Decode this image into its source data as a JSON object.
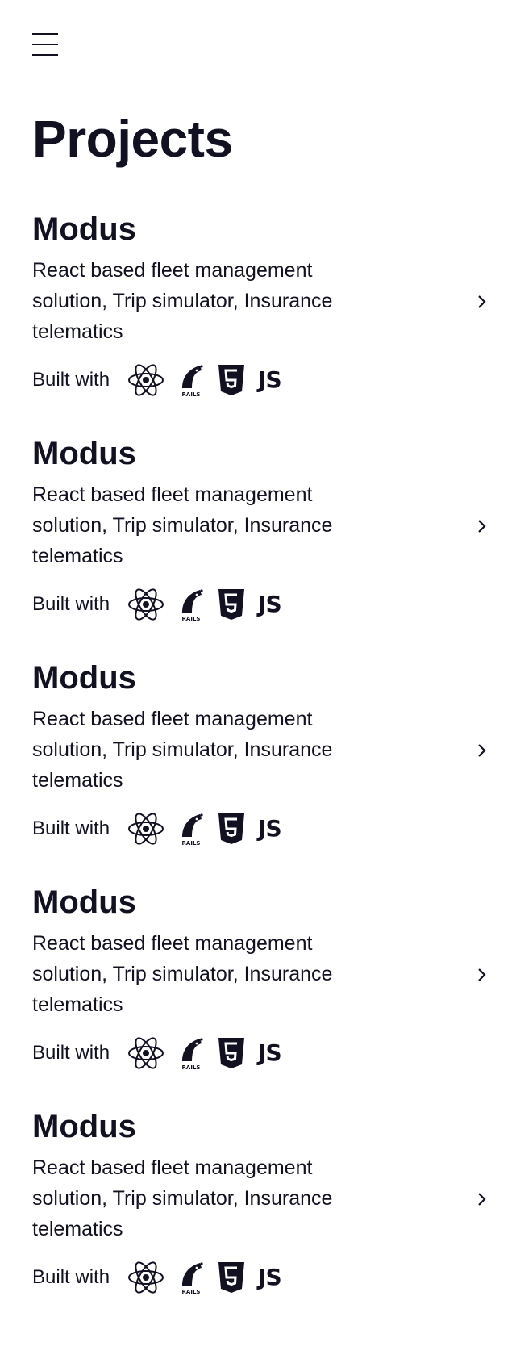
{
  "nav": {
    "menu_icon": "hamburger-menu-icon"
  },
  "page": {
    "title": "Projects"
  },
  "projects": [
    {
      "name": "Modus",
      "description": "React based fleet management solution, Trip simulator, Insurance telematics",
      "built_with_label": "Built with",
      "tech": [
        "react-icon",
        "rails-icon",
        "html5-icon",
        "js-icon"
      ],
      "tech_js_label": "JS",
      "rails_label": "RAILS"
    },
    {
      "name": "Modus",
      "description": "React based fleet management solution, Trip simulator, Insurance telematics",
      "built_with_label": "Built with",
      "tech": [
        "react-icon",
        "rails-icon",
        "html5-icon",
        "js-icon"
      ],
      "tech_js_label": "JS",
      "rails_label": "RAILS"
    },
    {
      "name": "Modus",
      "description": "React based fleet management solution, Trip simulator, Insurance telematics",
      "built_with_label": "Built with",
      "tech": [
        "react-icon",
        "rails-icon",
        "html5-icon",
        "js-icon"
      ],
      "tech_js_label": "JS",
      "rails_label": "RAILS"
    },
    {
      "name": "Modus",
      "description": "React based fleet management solution, Trip simulator, Insurance telematics",
      "built_with_label": "Built with",
      "tech": [
        "react-icon",
        "rails-icon",
        "html5-icon",
        "js-icon"
      ],
      "tech_js_label": "JS",
      "rails_label": "RAILS"
    },
    {
      "name": "Modus",
      "description": "React based fleet management solution, Trip simulator, Insurance telematics",
      "built_with_label": "Built with",
      "tech": [
        "react-icon",
        "rails-icon",
        "html5-icon",
        "js-icon"
      ],
      "tech_js_label": "JS",
      "rails_label": "RAILS"
    }
  ],
  "colors": {
    "text": "#111122",
    "background": "#ffffff"
  }
}
